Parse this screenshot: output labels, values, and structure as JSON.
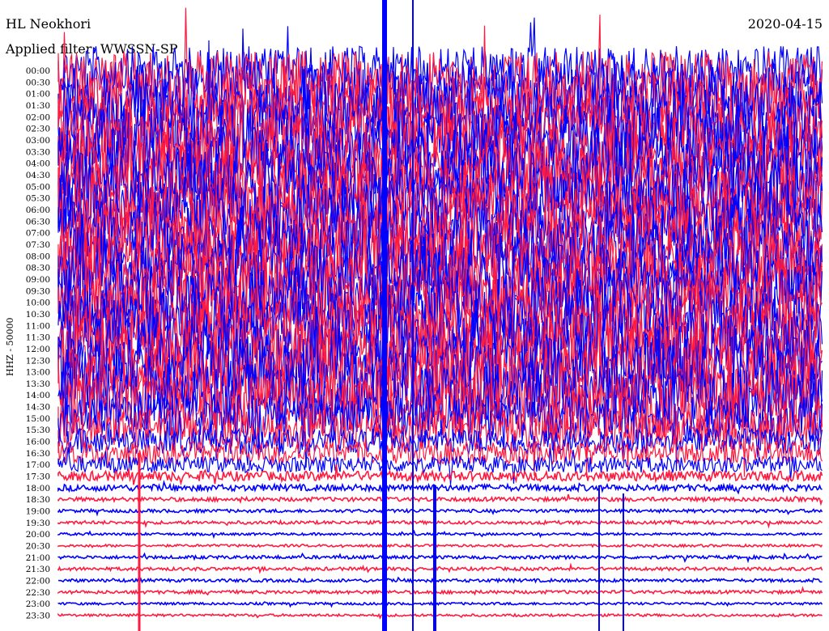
{
  "header": {
    "station": "HL Neokhori",
    "date": "2020-04-15",
    "filter": "Applied filter: WWSSN-SP"
  },
  "chart_data": {
    "type": "line",
    "title": "HL Neokhori",
    "ylabel": "HHZ - 50000",
    "trace_colors": [
      "#0000ff",
      "#ff1a40"
    ],
    "y_ticks": [
      "00:00",
      "00:30",
      "01:00",
      "01:30",
      "02:00",
      "02:30",
      "03:00",
      "03:30",
      "04:00",
      "04:30",
      "05:00",
      "05:30",
      "06:00",
      "06:30",
      "07:00",
      "07:30",
      "08:00",
      "08:30",
      "09:00",
      "09:30",
      "10:00",
      "10:30",
      "11:00",
      "11:30",
      "12:00",
      "12:30",
      "13:00",
      "13:30",
      "14:00",
      "14:30",
      "15:00",
      "15:30",
      "16:00",
      "16:30",
      "17:00",
      "17:30",
      "18:00",
      "18:30",
      "19:00",
      "19:30",
      "20:00",
      "20:30",
      "21:00",
      "21:30",
      "22:00",
      "22:30",
      "23:00",
      "23:30"
    ],
    "noise_level": [
      30,
      38,
      40,
      42,
      44,
      44,
      44,
      44,
      44,
      44,
      44,
      44,
      44,
      44,
      44,
      44,
      44,
      44,
      44,
      44,
      44,
      44,
      44,
      44,
      44,
      44,
      44,
      44,
      42,
      40,
      30,
      24,
      16,
      14,
      10,
      6,
      4,
      2.5,
      2,
      2,
      1.5,
      1.5,
      2,
      2,
      2,
      2,
      1.5,
      1.5
    ]
  }
}
